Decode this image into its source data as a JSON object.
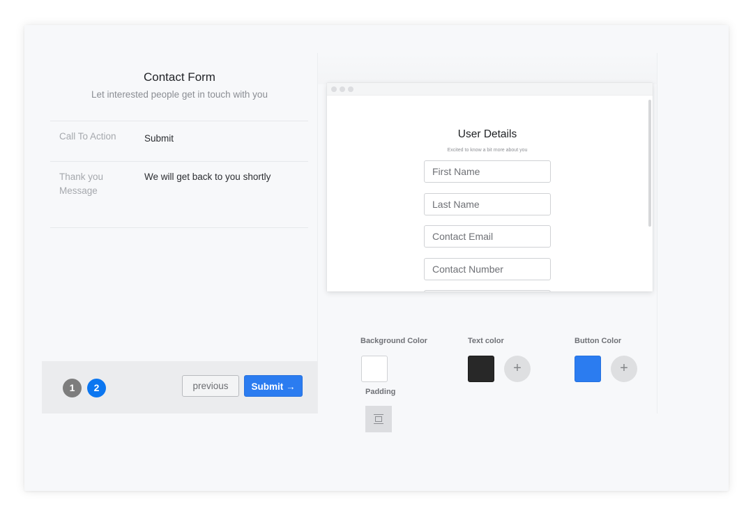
{
  "left_panel": {
    "title": "Contact Form",
    "subtitle": "Let interested people get in touch with you",
    "fields": [
      {
        "label": "Call To Action",
        "value": "Submit"
      },
      {
        "label": "Thank you Message",
        "value": "We will get back to you shortly"
      }
    ],
    "footer": {
      "steps": [
        {
          "number": "1",
          "state": "inactive"
        },
        {
          "number": "2",
          "state": "active"
        }
      ],
      "previous_label": "previous",
      "submit_label": "Submit",
      "submit_icon": "arrow-right-icon",
      "submit_arrow": "→"
    }
  },
  "preview": {
    "window_dots": [
      "close",
      "minimize",
      "maximize"
    ],
    "title": "User Details",
    "subtitle": "Excited to know a bit more about you",
    "inputs": [
      {
        "placeholder": "First Name"
      },
      {
        "placeholder": "Last Name"
      },
      {
        "placeholder": "Contact Email"
      },
      {
        "placeholder": "Contact Number"
      },
      {
        "placeholder": ""
      }
    ]
  },
  "styling": {
    "background_color": {
      "label": "Background Color",
      "value": "#ffffff"
    },
    "text_color": {
      "label": "Text color",
      "value": "#282828",
      "add_label": "+"
    },
    "button_color": {
      "label": "Button Color",
      "value": "#2b7cf0",
      "add_label": "+"
    },
    "padding": {
      "label": "Padding",
      "icon": "padding-icon"
    }
  },
  "colors": {
    "accent": "#2b7cf0",
    "step_active": "#0b76f0",
    "step_inactive": "#7d7d7d"
  }
}
